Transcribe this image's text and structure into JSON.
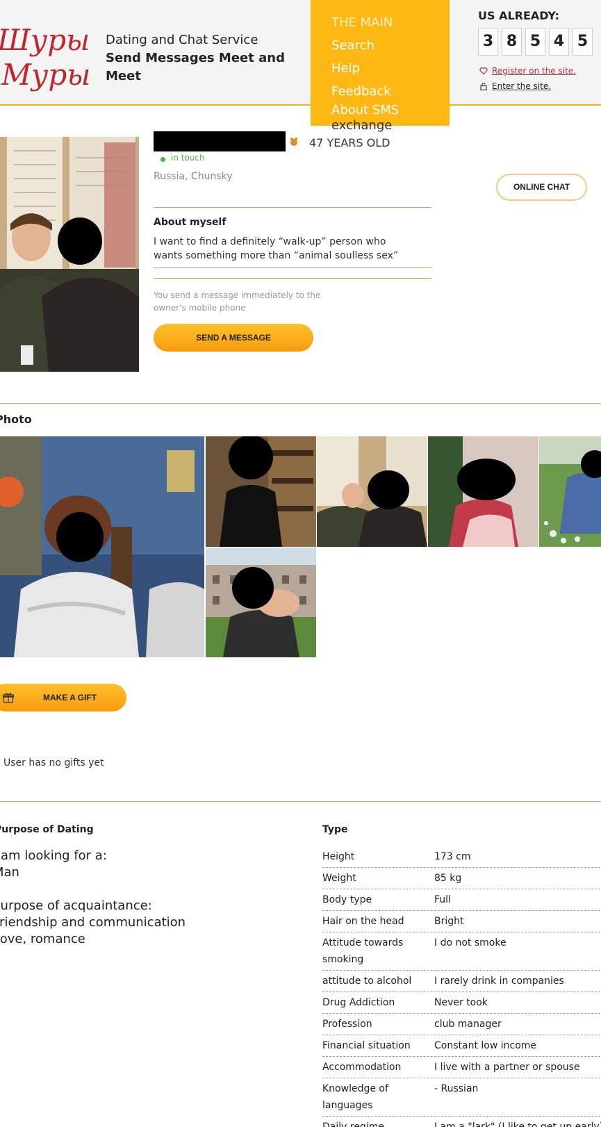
{
  "header": {
    "logo_line1": "Шуры",
    "logo_line2": "Муры",
    "tagline_regular": "Dating and Chat Service ",
    "tagline_bold": "Send Messages Meet and Meet",
    "menu": [
      {
        "label": "THE MAIN"
      },
      {
        "label": "Search"
      },
      {
        "label": "Help"
      },
      {
        "label": "Feedback"
      },
      {
        "label": "About SMS"
      },
      {
        "label": "exchange"
      }
    ],
    "counter_title": "US ALREADY:",
    "counter_digits": [
      "3",
      "8",
      "5",
      "4",
      "5"
    ],
    "register_link": "Register on the site.",
    "enter_link": "Enter the site."
  },
  "profile": {
    "age": "47 YEARS OLD",
    "status": "in touch",
    "location": "Russia, Chunsky",
    "online_chat": "ONLINE CHAT",
    "about_title": "About myself",
    "about_text": "I want to find a definitely “walk-up” person who wants something more than “animal soulless sex”",
    "send_note": "You send a message immediately to the owner's mobile phone",
    "send_button": "SEND A MESSAGE"
  },
  "photos": {
    "title": "Photo"
  },
  "gifts": {
    "button": "MAKE A GIFT",
    "empty": "User has no gifts yet"
  },
  "purpose": {
    "title": "Purpose of Dating",
    "looking_label": "I am looking for a:",
    "looking_value": "Man",
    "acq_label": "Purpose of acquaintance:",
    "acq_values": [
      "Friendship and communication",
      "Love, romance"
    ]
  },
  "type": {
    "title": "Type",
    "rows": [
      {
        "label": "Height",
        "value": "173 cm"
      },
      {
        "label": "Weight",
        "value": "85 kg"
      },
      {
        "label": "Body type",
        "value": "Full"
      },
      {
        "label": "Hair on the head",
        "value": "Bright"
      },
      {
        "label": "Attitude towards smoking",
        "value": "I do not smoke"
      },
      {
        "label": "attitude to alcohol",
        "value": "I rarely drink in companies"
      },
      {
        "label": "Drug Addiction",
        "value": "Never took"
      },
      {
        "label": "Profession",
        "value": "club manager"
      },
      {
        "label": "Financial situation",
        "value": "Constant low income"
      },
      {
        "label": "Accommodation",
        "value": "I live with a partner or spouse"
      },
      {
        "label": "Knowledge of languages",
        "value": "- Russian"
      },
      {
        "label": "Daily regime",
        "value": "I am a \"lark\" (I like to get up early)"
      }
    ]
  },
  "colors": {
    "accent": "#fdb813",
    "button": "#f79c0e",
    "logo": "#c0272d",
    "online": "#4cb848",
    "divider": "#d2a060"
  }
}
